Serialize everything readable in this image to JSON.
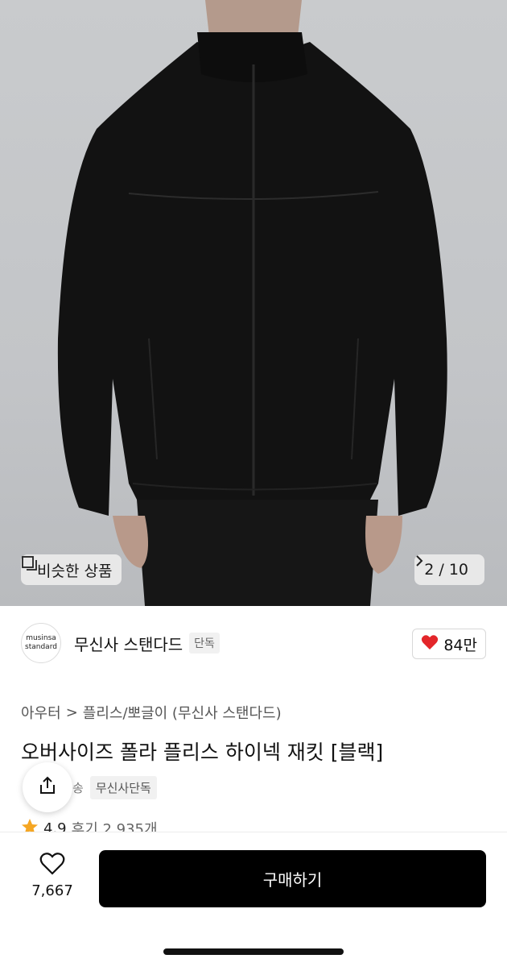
{
  "hero": {
    "similar_label": "비슷한 상품",
    "counter": "2 / 10",
    "icons": [
      "similar-products-icon",
      "chevron-right-icon"
    ]
  },
  "brand": {
    "logo_line1": "musinsa",
    "logo_line2": "standard",
    "name": "무신사 스탠다드",
    "badge": "단독",
    "likes": "84만",
    "accent": "#e3262a"
  },
  "breadcrumb": {
    "category": "아우터",
    "separator": ">",
    "subcategory": "플리스/뽀글이 (무신사 스탠다드)"
  },
  "product": {
    "title": "오버사이즈 폴라 플리스 하이넥 재킷 [블랙]",
    "tag_partial": "송",
    "tag_exclusive": "무신사단독",
    "rating": "4.9",
    "reviews": "후기 2,935개",
    "star_color": "#f5a623"
  },
  "bottom": {
    "wish_count": "7,667",
    "buy_label": "구매하기"
  }
}
